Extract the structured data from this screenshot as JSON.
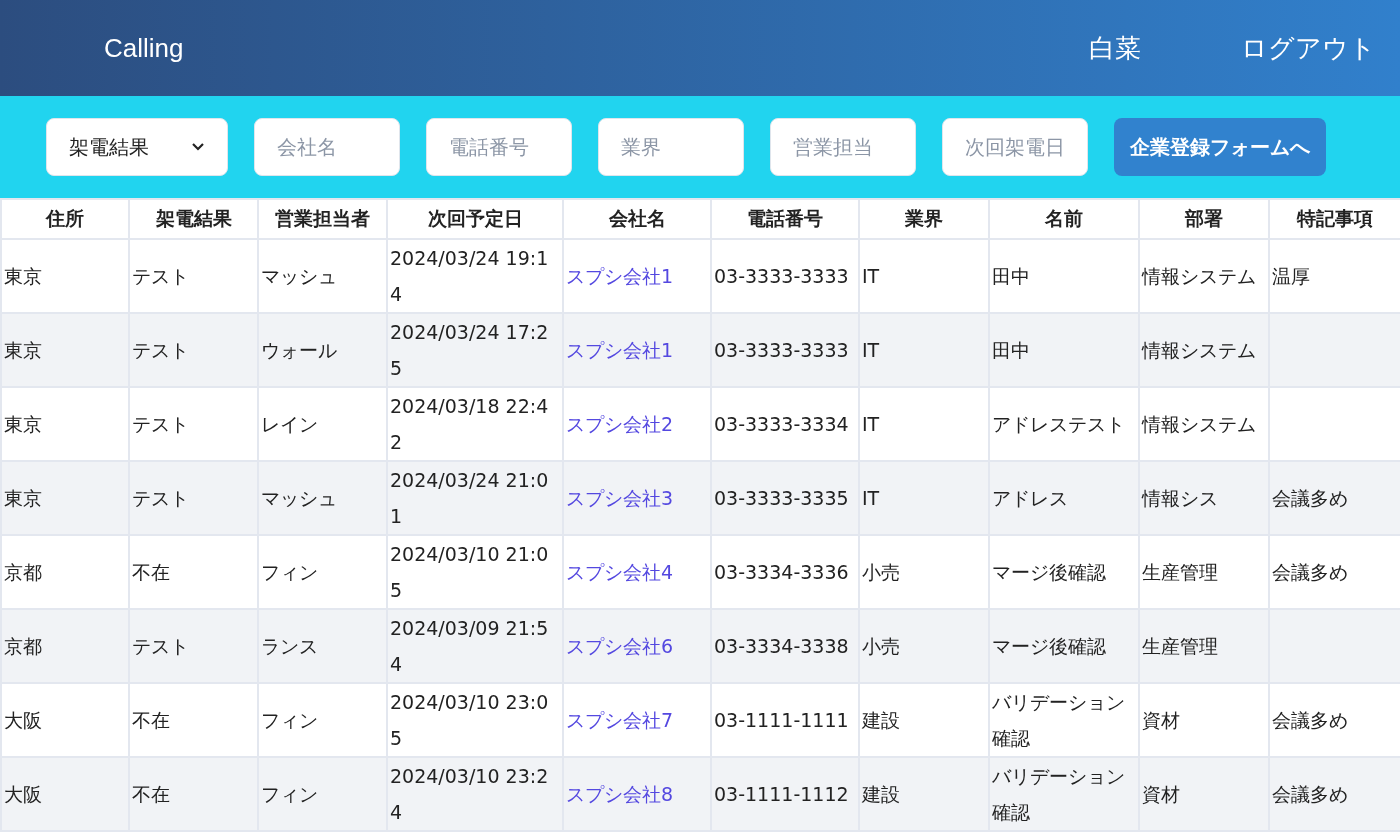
{
  "header": {
    "brand": "Calling",
    "user": "白菜",
    "logout": "ログアウト"
  },
  "filters": [
    {
      "kind": "select",
      "value": "架電結果"
    },
    {
      "kind": "input",
      "placeholder": "会社名"
    },
    {
      "kind": "input",
      "placeholder": "電話番号"
    },
    {
      "kind": "input",
      "placeholder": "業界"
    },
    {
      "kind": "input",
      "placeholder": "営業担当"
    },
    {
      "kind": "input",
      "placeholder": "次回架電日"
    }
  ],
  "register_button": "企業登録フォームへ",
  "table": {
    "columns": [
      {
        "label": "住所",
        "kind": "text"
      },
      {
        "label": "架電結果",
        "kind": "text"
      },
      {
        "label": "営業担当者",
        "kind": "text"
      },
      {
        "label": "次回予定日",
        "kind": "text"
      },
      {
        "label": "会社名",
        "kind": "link"
      },
      {
        "label": "電話番号",
        "kind": "text"
      },
      {
        "label": "業界",
        "kind": "text"
      },
      {
        "label": "名前",
        "kind": "text"
      },
      {
        "label": "部署",
        "kind": "text"
      },
      {
        "label": "特記事項",
        "kind": "text"
      }
    ],
    "rows": [
      [
        "東京",
        "テスト",
        "マッシュ",
        "2024/03/24 19:14",
        "スプシ会社1",
        "03-3333-3333",
        "IT",
        "田中",
        "情報システム",
        "温厚"
      ],
      [
        "東京",
        "テスト",
        "ウォール",
        "2024/03/24 17:25",
        "スプシ会社1",
        "03-3333-3333",
        "IT",
        "田中",
        "情報システム",
        ""
      ],
      [
        "東京",
        "テスト",
        "レイン",
        "2024/03/18 22:42",
        "スプシ会社2",
        "03-3333-3334",
        "IT",
        "アドレステスト",
        "情報システム",
        ""
      ],
      [
        "東京",
        "テスト",
        "マッシュ",
        "2024/03/24 21:01",
        "スプシ会社3",
        "03-3333-3335",
        "IT",
        "アドレス",
        "情報シス",
        "会議多め"
      ],
      [
        "京都",
        "不在",
        "フィン",
        "2024/03/10 21:05",
        "スプシ会社4",
        "03-3334-3336",
        "小売",
        "マージ後確認",
        "生産管理",
        "会議多め"
      ],
      [
        "京都",
        "テスト",
        "ランス",
        "2024/03/09 21:54",
        "スプシ会社6",
        "03-3334-3338",
        "小売",
        "マージ後確認",
        "生産管理",
        ""
      ],
      [
        "大阪",
        "不在",
        "フィン",
        "2024/03/10 23:05",
        "スプシ会社7",
        "03-1111-1111",
        "建設",
        "バリデーション確認",
        "資材",
        "会議多め"
      ],
      [
        "大阪",
        "不在",
        "フィン",
        "2024/03/10 23:24",
        "スプシ会社8",
        "03-1111-1112",
        "建設",
        "バリデーション確認",
        "資材",
        "会議多め"
      ]
    ]
  }
}
